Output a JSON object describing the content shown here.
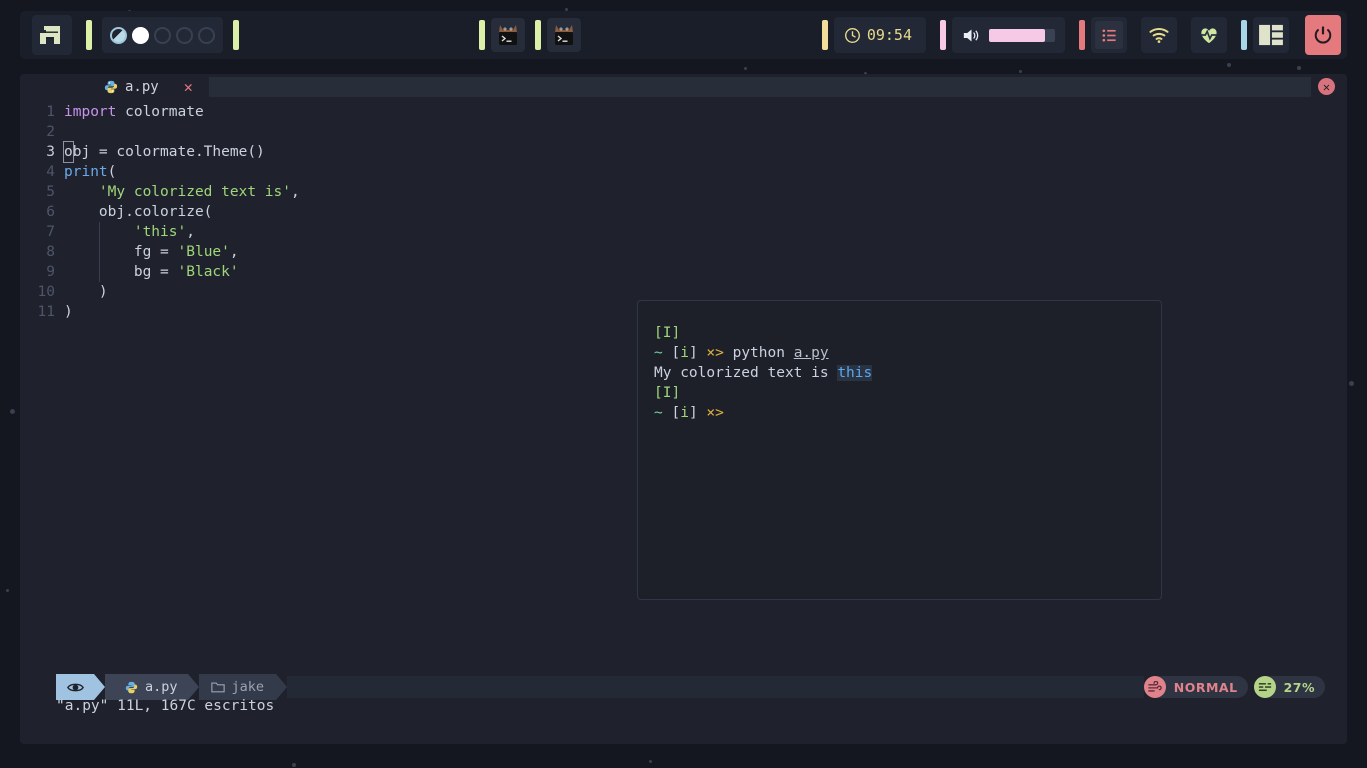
{
  "topbar": {
    "launcher": {
      "name": "app-launcher",
      "icon": "letter-a-logo"
    },
    "workspaces": [
      {
        "state": "partial"
      },
      {
        "state": "active"
      },
      {
        "state": "empty"
      },
      {
        "state": "empty"
      },
      {
        "state": "empty"
      }
    ],
    "tasks": [
      {
        "label": "terminal",
        "icon": "terminal-cat-icon"
      },
      {
        "label": "terminal",
        "icon": "terminal-cat-icon"
      }
    ],
    "clock": {
      "time": "09:54",
      "icon": "clock-icon"
    },
    "volume": {
      "icon": "speaker-icon",
      "level": 85
    },
    "tray": [
      {
        "name": "playlist-icon"
      },
      {
        "name": "wifi-icon"
      },
      {
        "name": "heartbeat-icon"
      },
      {
        "name": "layout-icon"
      }
    ],
    "power": {
      "name": "power-button",
      "icon": "power-icon"
    },
    "colors": {
      "accent_green": "#dcf0a8",
      "accent_yellow": "#f2dd9a",
      "accent_pink": "#f6c9e6",
      "accent_red": "#e4797e",
      "accent_blue": "#a9d5e8"
    }
  },
  "editor": {
    "tab": {
      "filename": "a.py",
      "icon": "python-icon",
      "close": "✕"
    },
    "window_close": "✕",
    "lines": [
      {
        "n": "1",
        "current": false,
        "tokens": [
          {
            "t": "import ",
            "c": "kw"
          },
          {
            "t": "colormate",
            "c": "plain"
          }
        ]
      },
      {
        "n": "2",
        "current": false,
        "tokens": []
      },
      {
        "n": "3",
        "current": true,
        "tokens": [
          {
            "t": "o",
            "c": "cursor"
          },
          {
            "t": "bj = colormate.Theme()",
            "c": "plain"
          }
        ]
      },
      {
        "n": "4",
        "current": false,
        "tokens": [
          {
            "t": "print",
            "c": "fn"
          },
          {
            "t": "(",
            "c": "plain"
          }
        ]
      },
      {
        "n": "5",
        "current": false,
        "tokens": [
          {
            "t": "    ",
            "c": "plain"
          },
          {
            "t": "'My colorized text is'",
            "c": "str"
          },
          {
            "t": ",",
            "c": "plain"
          }
        ]
      },
      {
        "n": "6",
        "current": false,
        "tokens": [
          {
            "t": "    obj.colorize(",
            "c": "plain"
          }
        ]
      },
      {
        "n": "7",
        "current": false,
        "tokens": [
          {
            "t": "        ",
            "c": "plain"
          },
          {
            "t": "'this'",
            "c": "str"
          },
          {
            "t": ",",
            "c": "plain"
          }
        ]
      },
      {
        "n": "8",
        "current": false,
        "tokens": [
          {
            "t": "        fg = ",
            "c": "plain"
          },
          {
            "t": "'Blue'",
            "c": "str"
          },
          {
            "t": ",",
            "c": "plain"
          }
        ]
      },
      {
        "n": "9",
        "current": false,
        "tokens": [
          {
            "t": "        bg = ",
            "c": "plain"
          },
          {
            "t": "'Black'",
            "c": "str"
          }
        ]
      },
      {
        "n": "10",
        "current": false,
        "tokens": [
          {
            "t": "    )",
            "c": "plain"
          }
        ]
      },
      {
        "n": "11",
        "current": false,
        "tokens": [
          {
            "t": ")",
            "c": "plain"
          }
        ]
      }
    ]
  },
  "terminal": {
    "lines": [
      [
        {
          "t": "[I]",
          "c": "g"
        }
      ],
      [
        {
          "t": "~ ",
          "c": "teal"
        },
        {
          "t": "[",
          "c": "plain"
        },
        {
          "t": "i",
          "c": "g"
        },
        {
          "t": "]",
          "c": "plain"
        },
        {
          "t": " ⨯> ",
          "c": "yel"
        },
        {
          "t": "python ",
          "c": "plain"
        },
        {
          "t": "a.py",
          "c": "ul"
        }
      ],
      [
        {
          "t": "My colorized text is ",
          "c": "plain"
        },
        {
          "t": "this",
          "c": "hl"
        }
      ],
      [
        {
          "t": "[I]",
          "c": "g"
        }
      ],
      [
        {
          "t": "~ ",
          "c": "teal"
        },
        {
          "t": "[",
          "c": "plain"
        },
        {
          "t": "i",
          "c": "g"
        },
        {
          "t": "]",
          "c": "plain"
        },
        {
          "t": " ⨯>",
          "c": "yel"
        }
      ]
    ]
  },
  "statusbar": {
    "mode_icon": "vim-eye-icon",
    "filename": "a.py",
    "file_icon": "python-icon",
    "directory": "jake",
    "dir_icon": "folder-icon",
    "mode": {
      "label": "NORMAL",
      "icon": "wind-icon",
      "color": "#e0838c"
    },
    "progress": {
      "label": "27%",
      "icon": "lines-icon",
      "color": "#b5d48a"
    }
  },
  "message": "\"a.py\" 11L, 167C escritos"
}
